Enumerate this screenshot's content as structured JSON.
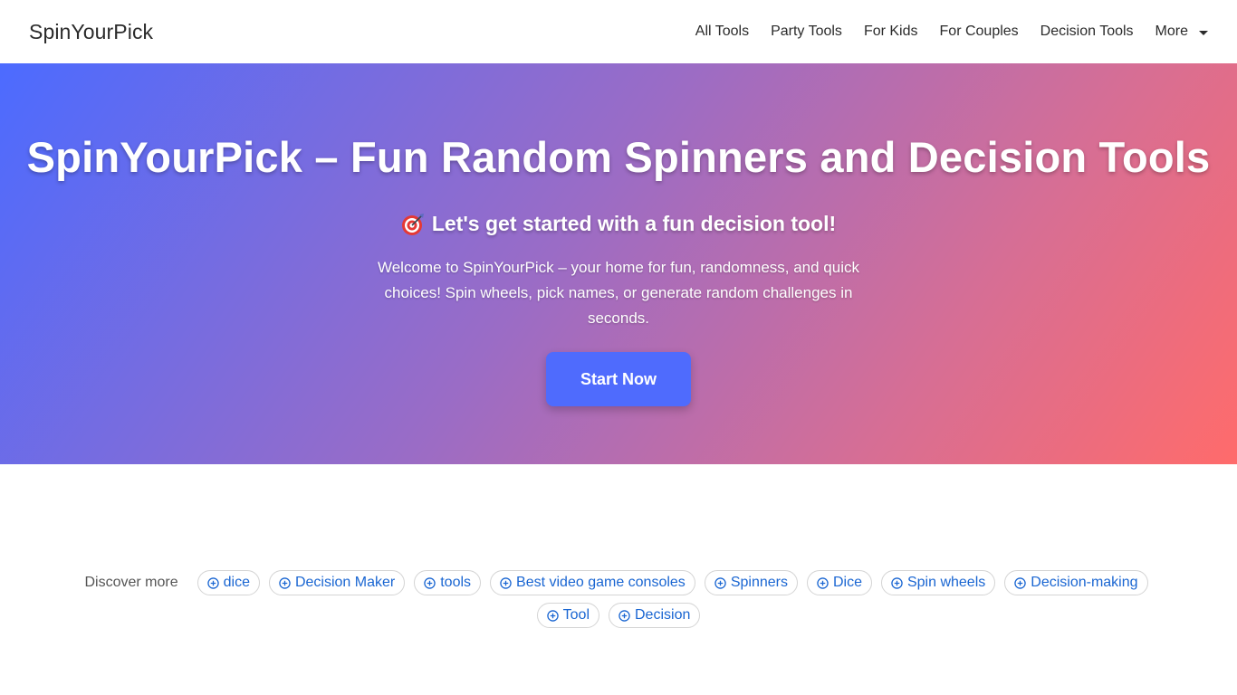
{
  "navbar": {
    "brand": "SpinYourPick",
    "links": [
      "All Tools",
      "Party Tools",
      "For Kids",
      "For Couples",
      "Decision Tools",
      "More"
    ]
  },
  "hero": {
    "title": "SpinYourPick – Fun Random Spinners and Decision Tools",
    "subtitle": "Let's get started with a fun decision tool!",
    "text": "Welcome to SpinYourPick – your home for fun, randomness, and quick choices! Spin wheels, pick names, or generate random challenges in seconds.",
    "button_label": "Start Now"
  },
  "discover": {
    "label": "Discover more",
    "chips_row1": [
      "dice",
      "Decision Maker",
      "tools",
      "Best video game consoles",
      "Spinners",
      "Dice",
      "Spin wheels",
      "Decision-making"
    ],
    "chips_row2": [
      "Tool",
      "Decision"
    ]
  },
  "icons": {
    "target": "target-emoji-icon",
    "chip": "plus-circle-icon",
    "more": "caret-down-icon"
  },
  "colors": {
    "gradient_start": "#4c6bff",
    "gradient_end": "#ff6b6b",
    "button_bg": "#4f6bfd",
    "chip_text": "#1a66d2"
  }
}
